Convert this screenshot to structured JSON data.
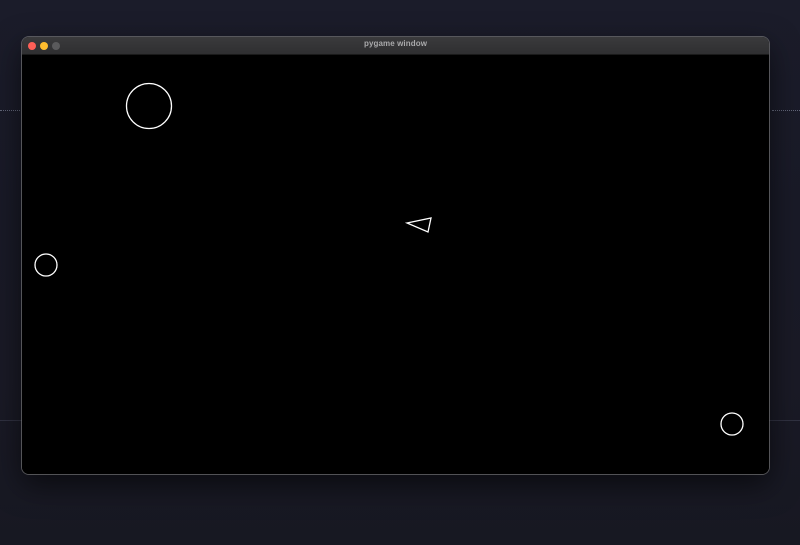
{
  "window": {
    "title": "pygame window",
    "controls": {
      "close_color": "#fe5f57",
      "minimize_color": "#febc2e",
      "zoom_color": "#5a5a5c"
    }
  },
  "game": {
    "background_color": "#000000",
    "stroke_color": "#ffffff",
    "player": {
      "shape": "triangle",
      "facing": "left"
    },
    "asteroids": [
      {
        "size": "large"
      },
      {
        "size": "small"
      },
      {
        "size": "small"
      }
    ]
  }
}
